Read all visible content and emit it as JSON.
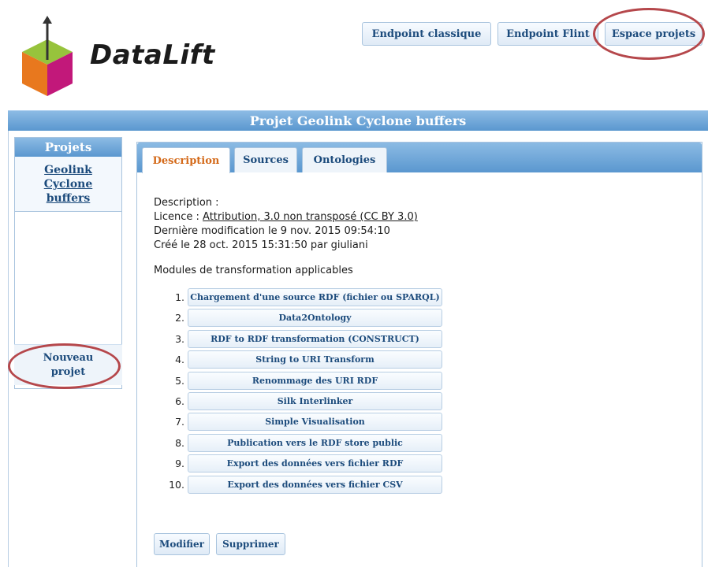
{
  "brand": {
    "name": "DataLift"
  },
  "topnav": {
    "endpoint_classic": "Endpoint classique",
    "endpoint_flint": "Endpoint Flint",
    "project_space": "Espace projets"
  },
  "page_title": "Projet Geolink Cyclone buffers",
  "sidebar": {
    "header": "Projets",
    "project_lines": [
      "Geolink",
      "Cyclone",
      "buffers"
    ],
    "new_project_lines": [
      "Nouveau",
      "projet"
    ]
  },
  "tabs": [
    "Description",
    "Sources",
    "Ontologies"
  ],
  "active_tab": "Description",
  "details": {
    "description_label": "Description :",
    "licence_label": "Licence : ",
    "licence_value": "Attribution, 3.0 non transposé (CC BY 3.0)",
    "modified": "Dernière modification le 9 nov. 2015 09:54:10",
    "created": "Créé le 28 oct. 2015 15:31:50 par giuliani"
  },
  "modules_title": "Modules de transformation applicables",
  "modules": [
    {
      "num": "1.",
      "label": "Chargement d'une source RDF (fichier ou SPARQL)"
    },
    {
      "num": "2.",
      "label": "Data2Ontology"
    },
    {
      "num": "3.",
      "label": "RDF to RDF transformation (CONSTRUCT)"
    },
    {
      "num": "4.",
      "label": "String to URI Transform"
    },
    {
      "num": "5.",
      "label": "Renommage des URI RDF"
    },
    {
      "num": "6.",
      "label": "Silk Interlinker"
    },
    {
      "num": "7.",
      "label": "Simple Visualisation"
    },
    {
      "num": "8.",
      "label": "Publication vers le RDF store public"
    },
    {
      "num": "9.",
      "label": "Export des données vers fichier RDF"
    },
    {
      "num": "10.",
      "label": "Export des données vers fichier CSV"
    }
  ],
  "actions": {
    "modify": "Modifier",
    "delete": "Supprimer"
  },
  "colors": {
    "accent": "#5a97cf",
    "active_tab_text": "#d46a1a",
    "highlight_circle": "#b5474b",
    "link": "#1c4b7c"
  }
}
